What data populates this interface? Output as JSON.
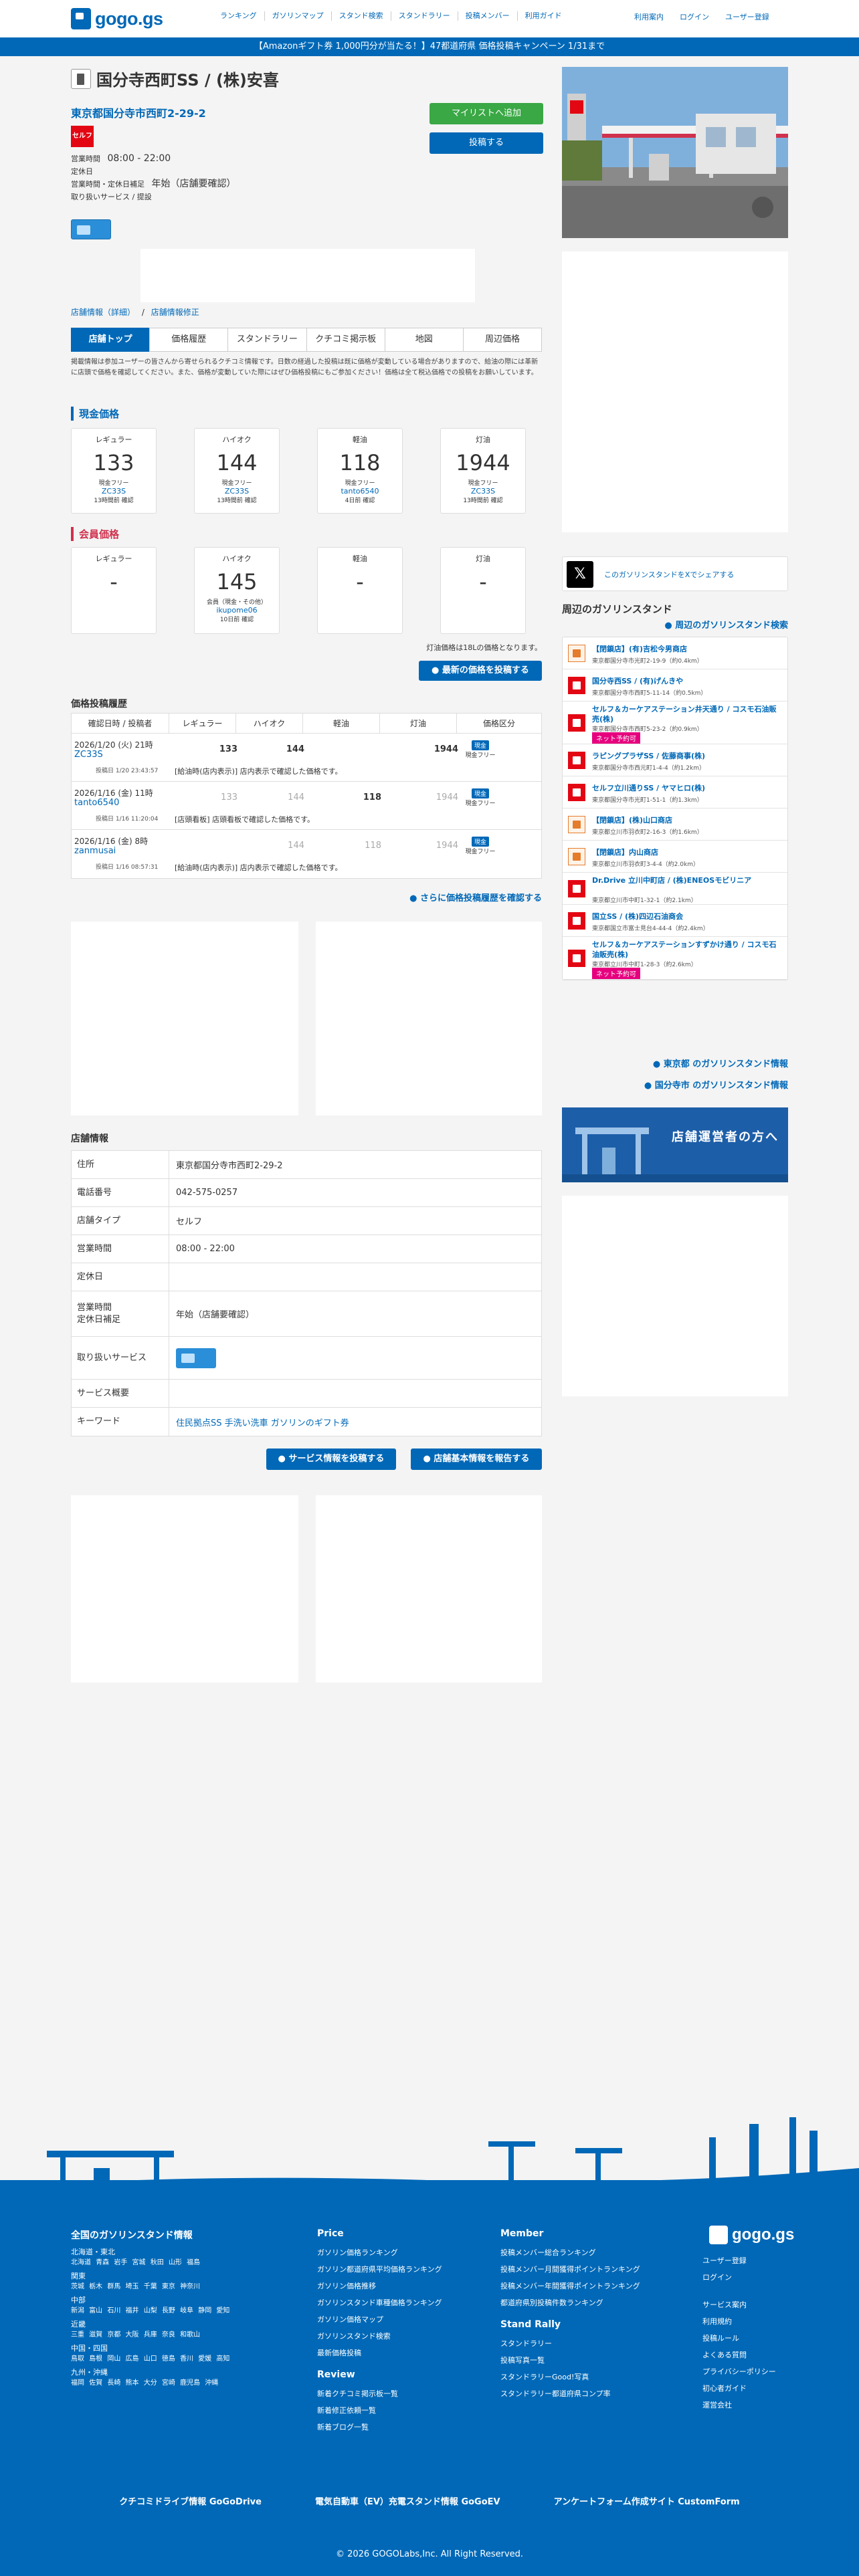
{
  "header": {
    "logo_text": "gogo.gs",
    "nav": [
      "ランキング",
      "ガソリンマップ",
      "スタンド検索",
      "スタンドラリー",
      "投稿メンバー",
      "利用ガイド"
    ],
    "nav_right": [
      "利用案内",
      "ログイン",
      "ユーザー登録"
    ]
  },
  "banner": "【Amazonギフト券 1,000円分が当たる！】47都道府県 価格投稿キャンペーン 1/31まで",
  "station": {
    "name": "国分寺西町SS / (株)安喜",
    "address": "東京都国分寺市西町2-29-2",
    "brand": "セルフ",
    "mylist_button": "マイリストへ追加",
    "post_button": "投稿する",
    "hours_label": "営業時間",
    "hours_value": "08:00 - 22:00",
    "holiday_label": "定休日",
    "holiday_note_label": "営業時間・定休日補足",
    "holiday_note_value": "年始（店舗要確認）",
    "service_label": "取り扱いサービス / 提設"
  },
  "breadcrumb": {
    "a": "店舗情報（詳細）",
    "sep": "/",
    "b": "店舗情報修正"
  },
  "tabs": [
    "店舗トップ",
    "価格履歴",
    "スタンドラリー",
    "クチコミ掲示板",
    "地図",
    "周辺価格"
  ],
  "notice": "掲載情報は参加ユーザーの皆さんから寄せられるクチコミ情報です。日数の経過した投稿は既に価格が変動している場合がありますので、給油の際には革新に店頭で価格を確認してください。また、価格が変動していた際にはぜひ価格投稿にもご参加ください！価格は全て税込価格での投稿をお願いしています。",
  "cash_title": "現金価格",
  "member_title": "会員価格",
  "cash_prices": [
    {
      "fuel": "レギュラー",
      "price": "133",
      "label": "現金フリー",
      "user": "ZC33S",
      "time": "13時間前 確認"
    },
    {
      "fuel": "ハイオク",
      "price": "144",
      "label": "現金フリー",
      "user": "ZC33S",
      "time": "13時間前 確認"
    },
    {
      "fuel": "軽油",
      "price": "118",
      "label": "現金フリー",
      "user": "tanto6540",
      "time": "4日前 確認"
    },
    {
      "fuel": "灯油",
      "price": "1944",
      "label": "現金フリー",
      "user": "ZC33S",
      "time": "13時間前 確認"
    }
  ],
  "member_prices": [
    {
      "fuel": "レギュラー",
      "price": "-",
      "label": "",
      "user": "",
      "time": ""
    },
    {
      "fuel": "ハイオク",
      "price": "145",
      "label": "会員（現金・その他）",
      "user": "ikupome06",
      "time": "10日前 確認"
    },
    {
      "fuel": "軽油",
      "price": "-",
      "label": "",
      "user": "",
      "time": ""
    },
    {
      "fuel": "灯油",
      "price": "-",
      "label": "",
      "user": "",
      "time": ""
    }
  ],
  "tokyu_note": "灯油価格は18Lの価格となります。",
  "post_price_button": "最新の価格を投稿する",
  "history": {
    "title": "価格投稿履歴",
    "headers": [
      "確認日時 / 投稿者",
      "レギュラー",
      "ハイオク",
      "軽油",
      "灯油",
      "価格区分"
    ],
    "rows": [
      {
        "date": "2026/1/20 (火) 21時",
        "user": "ZC33S",
        "reg": "133",
        "high": "144",
        "diesel": "",
        "kero": "1944",
        "kind": "現金",
        "kind_sub": "現金フリー",
        "meta": "投稿日 1/20 23:43:57",
        "comment": "[給油時(店内表示)] 店内表示で確認した価格です。",
        "dim": [
          false,
          false,
          false,
          false
        ]
      },
      {
        "date": "2026/1/16 (金) 11時",
        "user": "tanto6540",
        "reg": "133",
        "high": "144",
        "diesel": "118",
        "kero": "1944",
        "kind": "現金",
        "kind_sub": "現金フリー",
        "meta": "投稿日 1/16 11:20:04",
        "comment": "[店頭看板] 店頭看板で確認した価格です。",
        "dim": [
          true,
          true,
          false,
          true
        ]
      },
      {
        "date": "2026/1/16 (金) 8時",
        "user": "zanmusai",
        "reg": "",
        "high": "144",
        "diesel": "118",
        "kero": "1944",
        "kind": "現金",
        "kind_sub": "現金フリー",
        "meta": "投稿日 1/16 08:57:31",
        "comment": "[給油時(店内表示)] 店内表示で確認した価格です。",
        "dim": [
          true,
          true,
          true,
          true
        ]
      }
    ],
    "more_link": "さらに価格投稿履歴を確認する"
  },
  "shop_info": {
    "title": "店舗情報",
    "rows": [
      {
        "k": "住所",
        "v": "東京都国分寺市西町2-29-2"
      },
      {
        "k": "電話番号",
        "v": "042-575-0257"
      },
      {
        "k": "店舗タイプ",
        "v": "セルフ"
      },
      {
        "k": "営業時間",
        "v": "08:00 - 22:00"
      },
      {
        "k": "定休日",
        "v": ""
      },
      {
        "k": "営業時間\n定休日補足",
        "v": "年始（店舗要確認）"
      },
      {
        "k": "取り扱いサービス",
        "v": ""
      },
      {
        "k": "サービス概要",
        "v": ""
      },
      {
        "k": "キーワード",
        "v": "住民拠点SS 手洗い洗車 ガソリンのギフト券"
      }
    ],
    "btn_service": "サービス情報を投稿する",
    "btn_report": "店舗基本情報を報告する"
  },
  "sidebar": {
    "share_text": "このガソリンスタンドをXでシェアする",
    "nearby_title": "周辺のガソリンスタンド",
    "nearby_link": "周辺のガソリンスタンド検索",
    "nearby": [
      {
        "name": "【閉鎖店】(有)吉松今男商店",
        "addr": "東京都国分寺市光町2-19-9（約0.4km）",
        "red": false,
        "tag": ""
      },
      {
        "name": "国分寺西SS / (有)げんきや",
        "addr": "東京都国分寺市西町5-11-14（約0.5km）",
        "red": true,
        "tag": ""
      },
      {
        "name": "セルフ＆カーケアステーション井天通り / コスモ石油販売(株)",
        "addr": "東京都国分寺市西町5-23-2（約0.9km）",
        "red": true,
        "tag": "ネット予約可"
      },
      {
        "name": "ラピングプラザSS / 佐藤商事(株)",
        "addr": "東京都国分寺市西元町1-4-4（約1.2km）",
        "red": true,
        "tag": ""
      },
      {
        "name": "セルフ立川通りSS / ヤマヒロ(株)",
        "addr": "東京都国分寺市光町1-51-1（約1.3km）",
        "red": true,
        "tag": ""
      },
      {
        "name": "【閉鎖店】(株)山口商店",
        "addr": "東京都立川市羽衣町2-16-3（約1.6km）",
        "red": false,
        "tag": ""
      },
      {
        "name": "【閉鎖店】内山商店",
        "addr": "東京都立川市羽衣町3-4-4（約2.0km）",
        "red": false,
        "tag": ""
      },
      {
        "name": "Dr.Drive 立川中町店 / (株)ENEOSモビリニア",
        "addr": "東京都立川市中町1-32-1（約2.1km）",
        "red": true,
        "tag": ""
      },
      {
        "name": "国立SS / (株)四辺石油商会",
        "addr": "東京都国立市富士見台4-44-4（約2.4km）",
        "red": true,
        "tag": ""
      },
      {
        "name": "セルフ＆カーケアステーションすずかけ通り / コスモ石油販売(株)",
        "addr": "東京都立川市中町1-28-3（約2.6km）",
        "red": true,
        "tag": "ネット予約可"
      }
    ],
    "link_tokyo": "東京都 のガソリンスタンド情報",
    "link_city": "国分寺市 のガソリンスタンド情報",
    "owner_banner": "店舗運営者の方へ"
  },
  "footer": {
    "logo": "gogo.gs",
    "col1_title": "全国のガソリンスタンド情報",
    "regions": [
      {
        "name": "北海道・東北",
        "prefs": "北海道 青森 岩手 宮城 秋田 山形 福島"
      },
      {
        "name": "関東",
        "prefs": "茨城 栃木 群馬 埼玉 千葉 東京 神奈川"
      },
      {
        "name": "中部",
        "prefs": "新潟 富山 石川 福井 山梨 長野 岐阜 静岡 愛知"
      },
      {
        "name": "近畿",
        "prefs": "三重 滋賀 京都 大阪 兵庫 奈良 和歌山"
      },
      {
        "name": "中国・四国",
        "prefs": "鳥取 島根 岡山 広島 山口 徳島 香川 愛媛 高知"
      },
      {
        "name": "九州・沖縄",
        "prefs": "福岡 佐賀 長崎 熊本 大分 宮崎 鹿児島 沖縄"
      }
    ],
    "price_title": "Price",
    "price_links": [
      "ガソリン価格ランキング",
      "ガソリン都道府県平均価格ランキング",
      "ガソリン価格推移",
      "ガソリンスタンド車種価格ランキング",
      "ガソリン価格マップ",
      "ガソリンスタンド検索",
      "最新価格投稿"
    ],
    "review_title": "Review",
    "review_links": [
      "新着クチコミ掲示板一覧",
      "新着修正依頼一覧",
      "新着ブログ一覧"
    ],
    "member_title": "Member",
    "member_links": [
      "投稿メンバー総合ランキング",
      "投稿メンバー月間獲得ポイントランキング",
      "投稿メンバー年間獲得ポイントランキング",
      "都道府県別投稿件数ランキング"
    ],
    "rally_title": "Stand Rally",
    "rally_links": [
      "スタンドラリー",
      "投稿写真一覧",
      "スタンドラリーGood!写真",
      "スタンドラリー都道府県コンプ率"
    ],
    "right_links_a": [
      "ユーザー登録",
      "ログイン"
    ],
    "right_links_b": [
      "サービス案内",
      "利用規約",
      "投稿ルール",
      "よくある質問",
      "プライバシーポリシー",
      "初心者ガイド",
      "運営会社"
    ],
    "bottom_links": [
      "クチコミドライブ情報 GoGoDrive",
      "電気自動車（EV）充電スタンド情報 GoGoEV",
      "アンケートフォーム作成サイト CustomForm"
    ],
    "copyright": "© 2026 GOGOLabs,Inc. All Right Reserved."
  }
}
